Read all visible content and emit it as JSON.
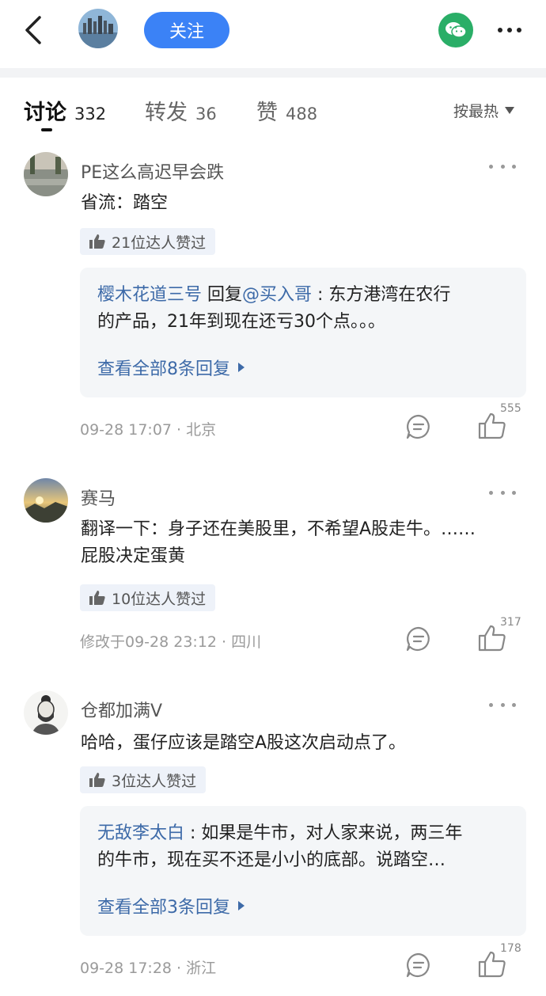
{
  "header": {
    "follow_label": "关注"
  },
  "tabs": [
    {
      "label": "讨论",
      "count": "332"
    },
    {
      "label": "转发",
      "count": "36"
    },
    {
      "label": "赞",
      "count": "488"
    }
  ],
  "sort": {
    "label": "按最热"
  },
  "comments": [
    {
      "author": "PE这么高迟早会跌",
      "text": "省流：踏空",
      "badge": "21位达人赞过",
      "reply": {
        "author": "樱木花道三号",
        "reply_word": " 回复",
        "mention": "@买入哥",
        "text_line1": " : 东方港湾在农行",
        "text_line2": "的产品，21年到现在还亏30个点。。。",
        "view_all": "查看全部8条回复"
      },
      "meta": "09-28 17:07 · 北京",
      "likes": "555"
    },
    {
      "author": "赛马",
      "text_line1": "翻译一下：身子还在美股里，不希望A股走牛。……",
      "text_line2": "屁股决定蛋黄",
      "badge": "10位达人赞过",
      "meta": "修改于09-28 23:12 · 四川",
      "likes": "317"
    },
    {
      "author": "仓都加满V",
      "text": "哈哈，蛋仔应该是踏空A股这次启动点了。",
      "badge": "3位达人赞过",
      "reply": {
        "author": "无敌李太白",
        "text_line1": " : 如果是牛市，对人家来说，两三年",
        "text_line2": "的牛市，现在买不还是小小的底部。说踏空…",
        "view_all": "查看全部3条回复"
      },
      "meta": "09-28 17:28 · 浙江",
      "likes": "178"
    }
  ]
}
